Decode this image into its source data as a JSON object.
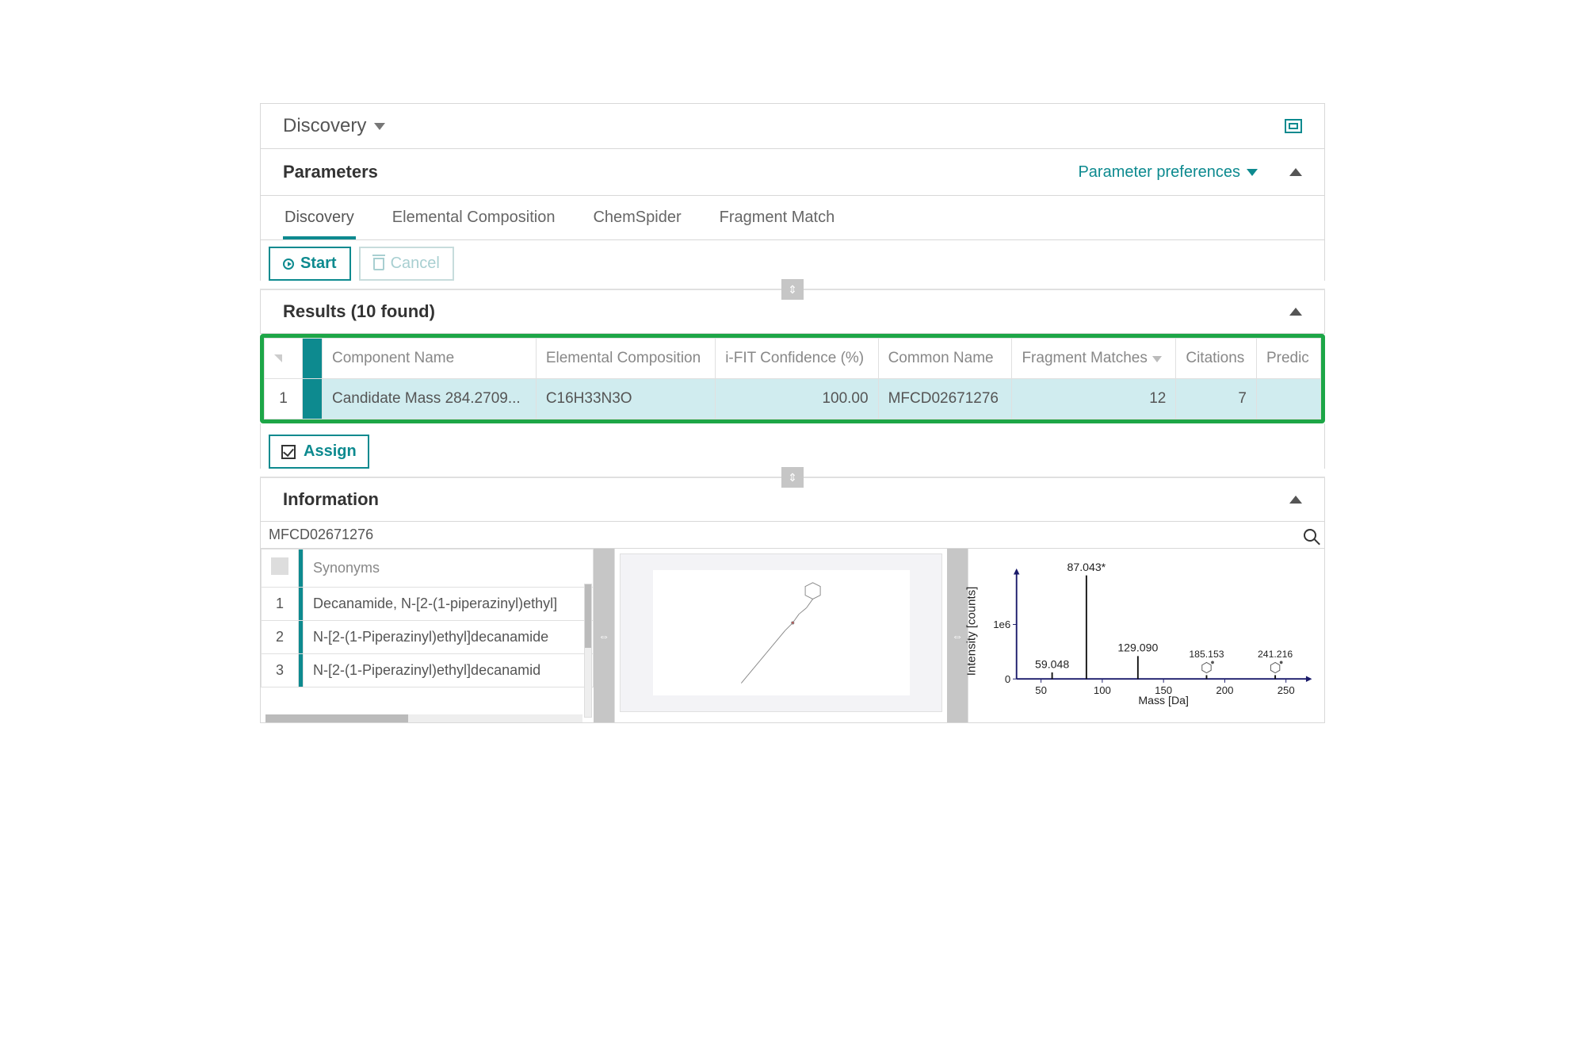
{
  "header": {
    "title": "Discovery"
  },
  "parameters": {
    "title": "Parameters",
    "prefs_label": "Parameter preferences"
  },
  "tabs": [
    {
      "label": "Discovery",
      "active": true
    },
    {
      "label": "Elemental Composition",
      "active": false
    },
    {
      "label": "ChemSpider",
      "active": false
    },
    {
      "label": "Fragment Match",
      "active": false
    }
  ],
  "actions": {
    "start": "Start",
    "cancel": "Cancel"
  },
  "results": {
    "title": "Results (10 found)",
    "columns": [
      "Component Name",
      "Elemental Composition",
      "i-FIT Confidence (%)",
      "Common Name",
      "Fragment Matches",
      "Citations",
      "Predic"
    ],
    "rows": [
      {
        "n": "1",
        "component_name": "Candidate Mass 284.2709...",
        "elemental": "C16H33N3O",
        "ifit": "100.00",
        "common_name": "MFCD02671276",
        "fragment_matches": "12",
        "citations": "7"
      }
    ]
  },
  "assign": {
    "label": "Assign"
  },
  "information": {
    "title": "Information",
    "id": "MFCD02671276",
    "synonyms_header": "Synonyms",
    "synonyms": [
      {
        "n": "1",
        "name": "Decanamide, N-[2-(1-piperazinyl)ethyl]"
      },
      {
        "n": "2",
        "name": "N-[2-(1-Piperazinyl)ethyl]decanamide"
      },
      {
        "n": "3",
        "name": "N-[2-(1-Piperazinyl)ethyl]decanamid"
      }
    ]
  },
  "chart_data": {
    "type": "bar",
    "title": "",
    "xlabel": "Mass [Da]",
    "ylabel": "Intensity [counts]",
    "xlim": [
      30,
      270
    ],
    "ylim": [
      0,
      2000000
    ],
    "yticks": [
      0,
      1000000
    ],
    "ytick_labels": [
      "0",
      "1e6"
    ],
    "xticks": [
      50,
      100,
      150,
      200,
      250
    ],
    "peaks": [
      {
        "mass": 59.048,
        "intensity": 120000,
        "label": "59.048"
      },
      {
        "mass": 87.043,
        "intensity": 1900000,
        "label": "87.043*"
      },
      {
        "mass": 129.09,
        "intensity": 420000,
        "label": "129.090"
      },
      {
        "mass": 185.153,
        "intensity": 70000,
        "label": "185.153",
        "marker": "benzene"
      },
      {
        "mass": 241.216,
        "intensity": 70000,
        "label": "241.216",
        "marker": "benzene"
      }
    ]
  }
}
